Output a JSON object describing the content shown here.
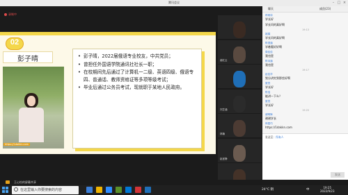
{
  "window": {
    "title": "腾讯会议"
  },
  "meeting": {
    "recording_label": "录制中",
    "bottom_label": "王心怡的屏幕共享"
  },
  "slide": {
    "number": "02",
    "name": "彭子晴",
    "watermark": "https://1dakkn.com",
    "bullets": [
      "彭子晴，2022届俄语专业校友，中共党员；",
      "曾担任外国语学院通讯社社长一职；",
      "在校期间先后通过了计算机一二级、英语四级、俄语专四、普通话、教师资格证等多项等级考试；",
      "毕业后通过公务员考试，现就职于某地人民政府。"
    ]
  },
  "video_tiles": [
    {
      "name": "",
      "color": "#3a2a22"
    },
    {
      "name": "谢红云",
      "color": "#5a4a40"
    },
    {
      "name": "",
      "color": "#1f6fb8"
    },
    {
      "name": "刘芷涵",
      "color": "#2b2b2b"
    },
    {
      "name": "林楠",
      "color": "#4c3b33"
    },
    {
      "name": "赵宜静",
      "color": "#6b5b50"
    },
    {
      "name": "胡舒婷",
      "color": "#443228"
    }
  ],
  "chat": {
    "tab_all": "聊天",
    "tab_members": "成员(23)",
    "to_label": "发送至：",
    "to_value": "所有人",
    "send_label": "发送",
    "messages": [
      {
        "who": "林雨诗",
        "text": "学长好"
      },
      {
        "who": "",
        "text": "学长问的真好啊"
      },
      {
        "time": "19:13"
      },
      {
        "who": "姚娟",
        "text": "学长问的真好啊"
      },
      {
        "who": "陈语涵",
        "text": "学着看好好啊"
      },
      {
        "who": "周佳佳",
        "text": "我也是"
      },
      {
        "who": "陈诗涵",
        "text": "我也是"
      },
      {
        "time": "19:17"
      },
      {
        "who": "赵佳华",
        "text": "划分讲究到那些好啊"
      },
      {
        "who": "夏悦",
        "text": "学长好"
      },
      {
        "who": "陈浩",
        "text": "能讲一下么？"
      },
      {
        "who": "夏悦",
        "text": "学长好"
      },
      {
        "time": "19:20"
      },
      {
        "who": "谢明辉",
        "text": "谢谢学长"
      },
      {
        "who": "林嘉巧",
        "text": "https://1dakkn.com"
      }
    ]
  },
  "taskbar": {
    "search_placeholder": "在这里输入你要搜索的内容",
    "weather": "24°C 阴",
    "ime": "中",
    "time": "19:25",
    "date": "2022/9/23",
    "apps": [
      "#3b7ed8",
      "#f0b400",
      "#2d8cff",
      "#5a8f29",
      "#0078d4",
      "#d13438",
      "#1f6fb8"
    ]
  }
}
